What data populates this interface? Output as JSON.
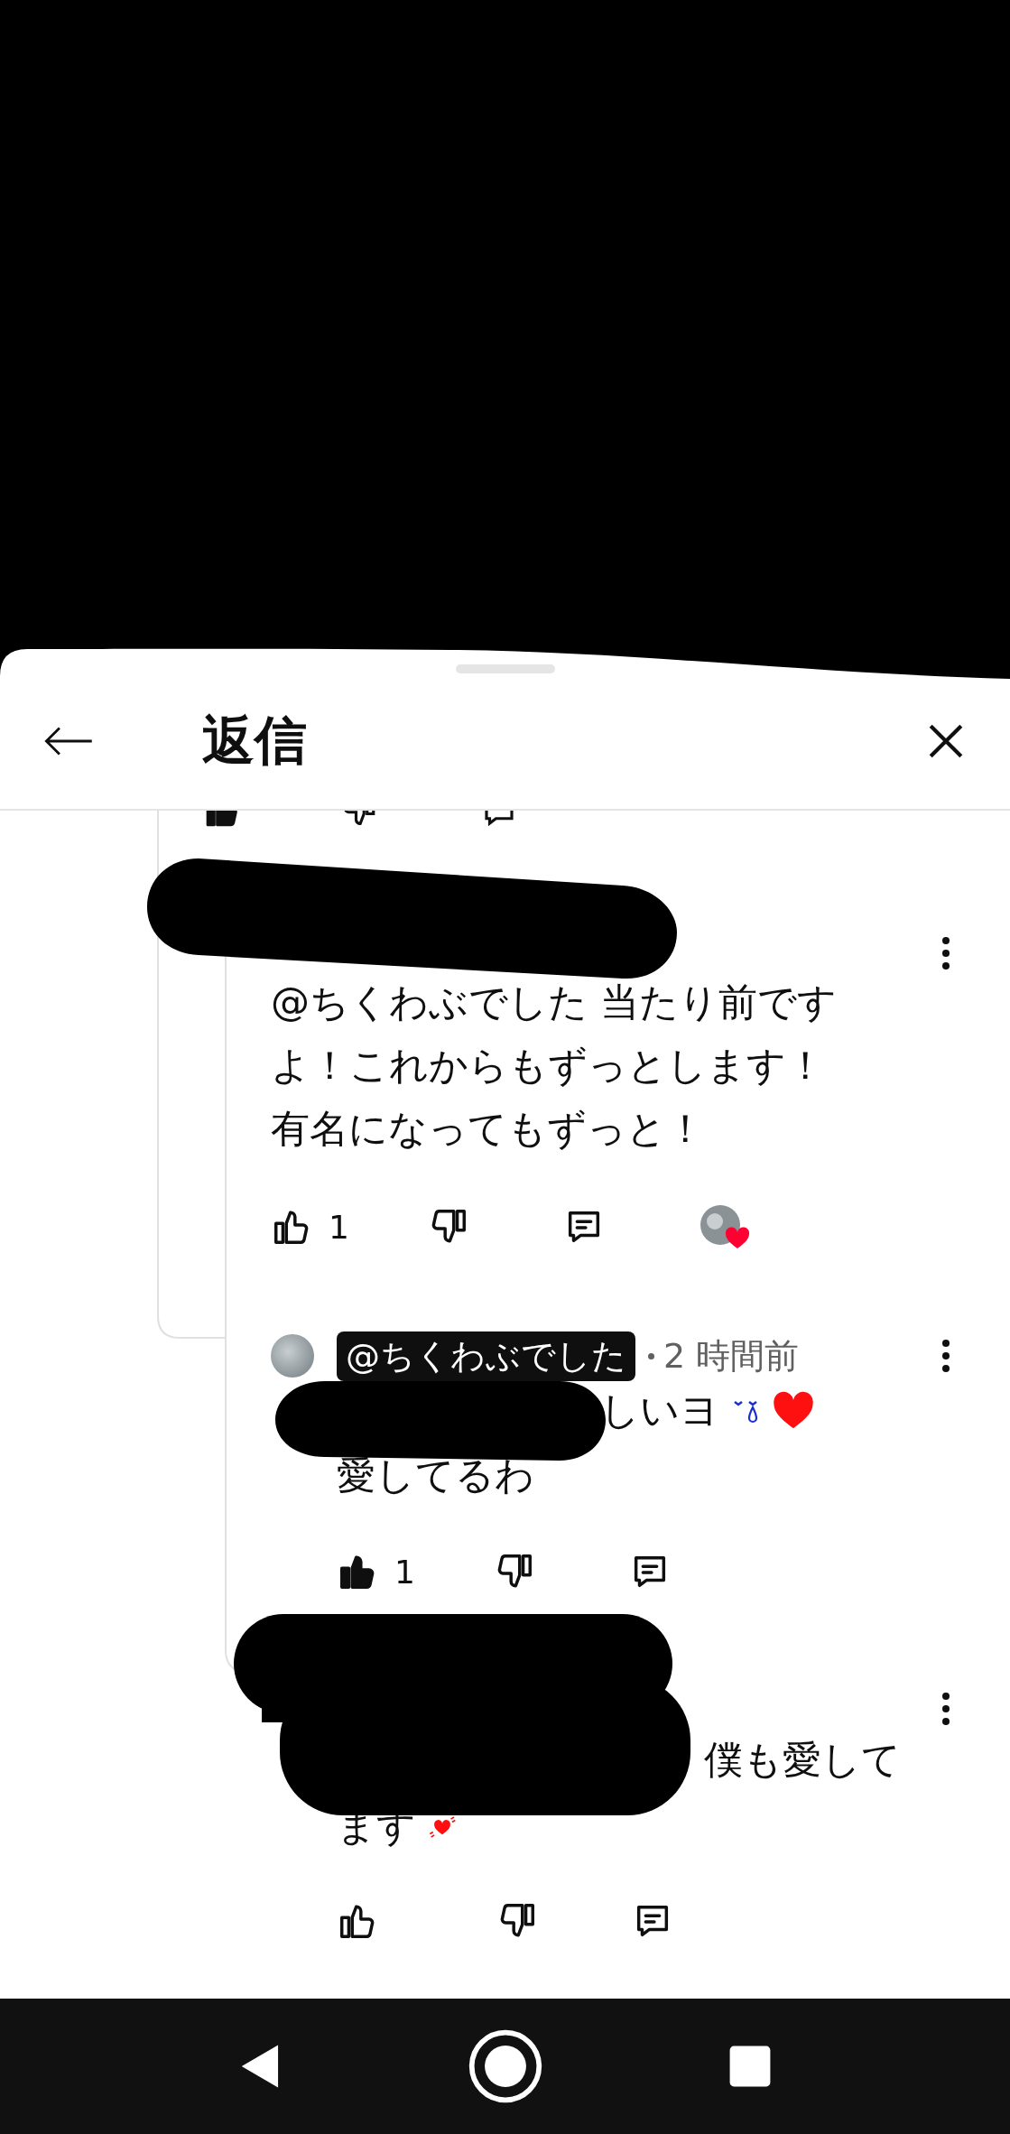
{
  "header": {
    "title": "返信"
  },
  "previous_actions": {
    "liked": true
  },
  "comment": {
    "lines": [
      {
        "text": "@ちくわぶでした 当たり前です"
      },
      {
        "text": "よ！これからもずっとします！"
      },
      {
        "text": "有名になってもずっと！"
      }
    ],
    "likes": "1",
    "liked": false,
    "hearted": true,
    "replies": [
      {
        "author": "@ちくわぶでした",
        "author_highlighted": true,
        "time": "2 時間前",
        "lines": [
          {
            "text": "しいヨ"
          },
          {
            "text": "愛してるわ"
          }
        ],
        "likes": "1",
        "liked": true
      },
      {
        "lines": [
          {
            "text": "僕も愛して"
          },
          {
            "text": "ます"
          }
        ],
        "liked": false
      }
    ]
  }
}
